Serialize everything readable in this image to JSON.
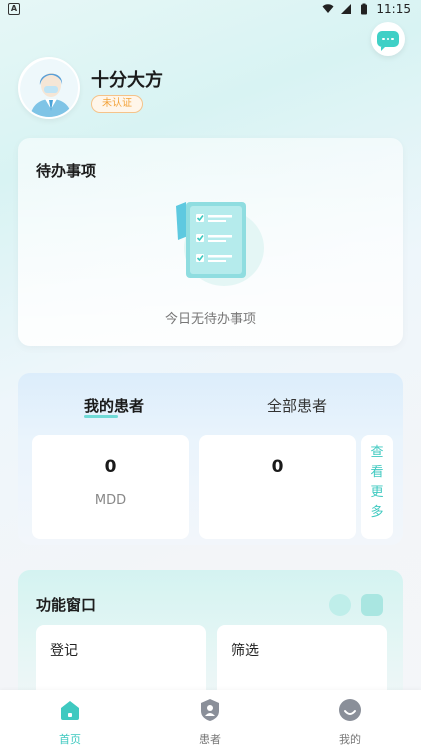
{
  "status_bar": {
    "app_icon": "A",
    "time": "11:15",
    "icons": [
      "wifi-icon",
      "signal-icon",
      "battery-icon"
    ]
  },
  "header": {
    "username": "十分大方",
    "cert_status": "未认证"
  },
  "todo": {
    "title": "待办事项",
    "empty_text": "今日无待办事项"
  },
  "patients": {
    "tab_mine": "我的患者",
    "tab_all": "全部患者",
    "stats": [
      {
        "value": "0",
        "label": "MDD"
      },
      {
        "value": "0",
        "label": ""
      }
    ],
    "more_chars": [
      "查",
      "看",
      "更",
      "多"
    ]
  },
  "functions": {
    "title": "功能窗口",
    "items": [
      {
        "label": "登记"
      },
      {
        "label": "筛选"
      }
    ]
  },
  "bottom_nav": {
    "items": [
      {
        "label": "首页",
        "icon": "home-icon",
        "active": true
      },
      {
        "label": "患者",
        "icon": "patient-icon",
        "active": false
      },
      {
        "label": "我的",
        "icon": "profile-icon",
        "active": false
      }
    ]
  },
  "colors": {
    "accent": "#3fc9c0",
    "cert_badge": "#f2a33a",
    "background": "#e6f7f6"
  }
}
